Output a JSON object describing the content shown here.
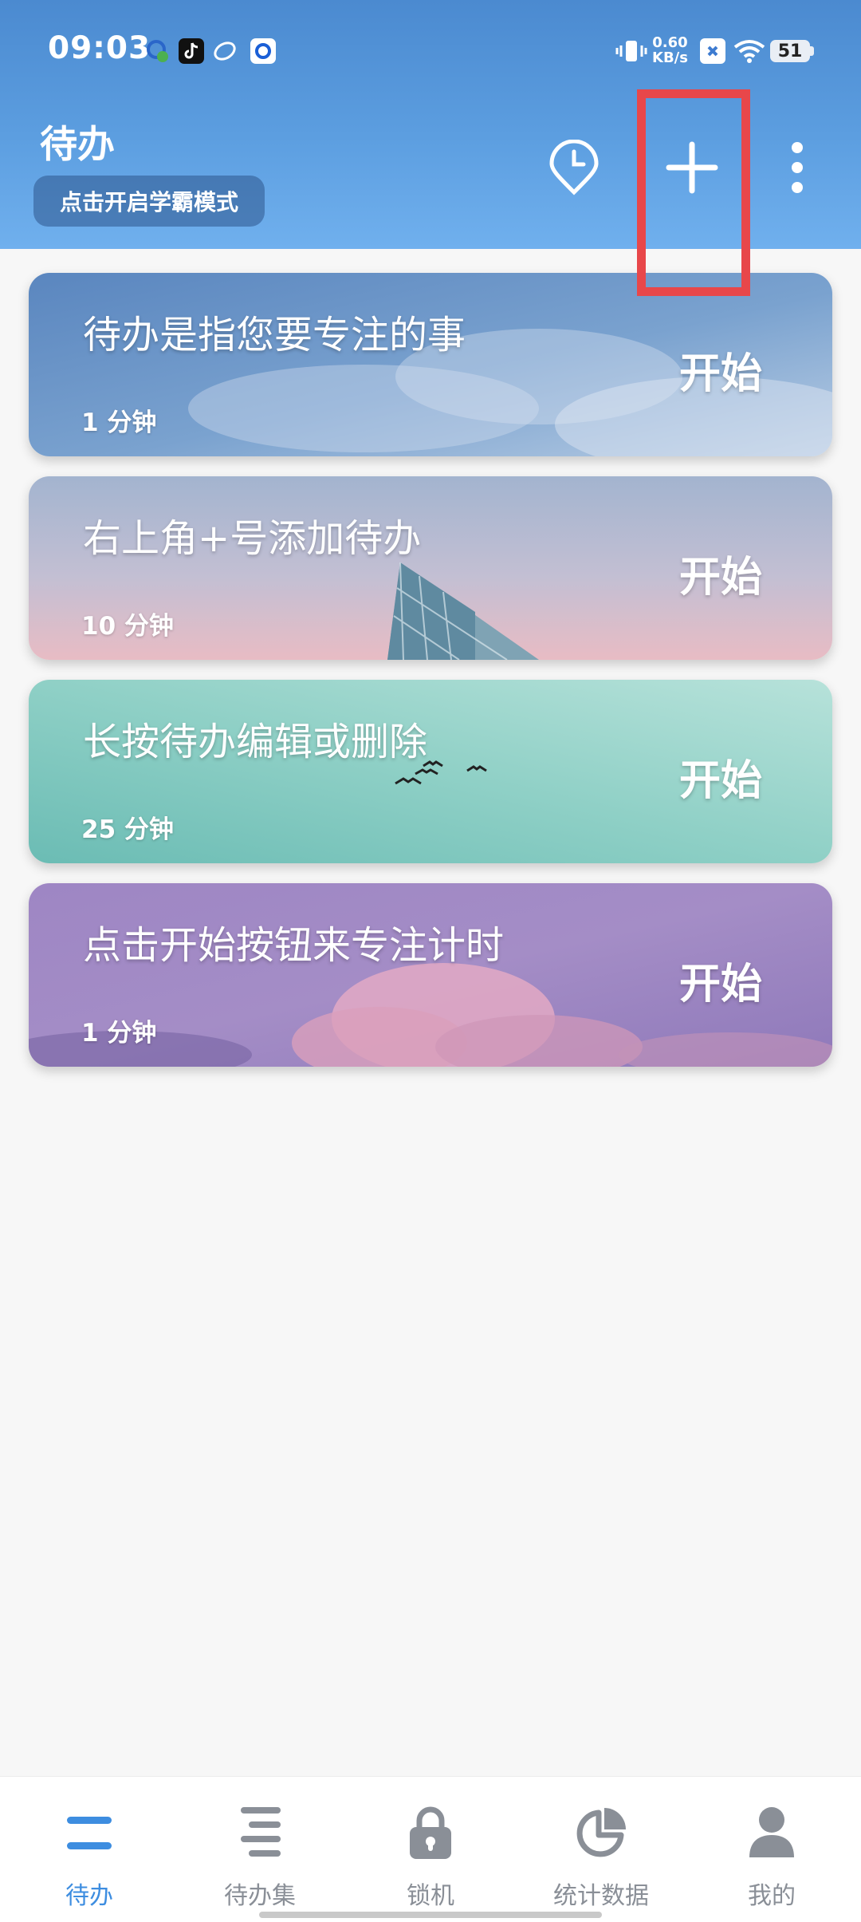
{
  "status_bar": {
    "time": "09:03",
    "net_speed_value": "0.60",
    "net_speed_unit": "KB/s",
    "battery": "51"
  },
  "header": {
    "title": "待办",
    "focus_mode_label": "点击开启学霸模式"
  },
  "cards": [
    {
      "title": "待办是指您要专注的事",
      "duration": "1 分钟",
      "start_label": "开始"
    },
    {
      "title": "右上角+号添加待办",
      "duration": "10 分钟",
      "start_label": "开始"
    },
    {
      "title": "长按待办编辑或删除",
      "duration": "25 分钟",
      "start_label": "开始"
    },
    {
      "title": "点击开始按钮来专注计时",
      "duration": "1 分钟",
      "start_label": "开始"
    }
  ],
  "bottom_nav": [
    {
      "label": "待办",
      "icon": "todo-icon",
      "active": true
    },
    {
      "label": "待办集",
      "icon": "todo-set-icon",
      "active": false
    },
    {
      "label": "锁机",
      "icon": "lock-icon",
      "active": false
    },
    {
      "label": "统计数据",
      "icon": "pie-chart-icon",
      "active": false
    },
    {
      "label": "我的",
      "icon": "person-icon",
      "active": false
    }
  ],
  "colors": {
    "header_top": "#4b8ad0",
    "header_bottom": "#70b0ee",
    "accent": "#3d8de0",
    "nav_inactive": "#8a8f97",
    "highlight": "#e8474a"
  }
}
